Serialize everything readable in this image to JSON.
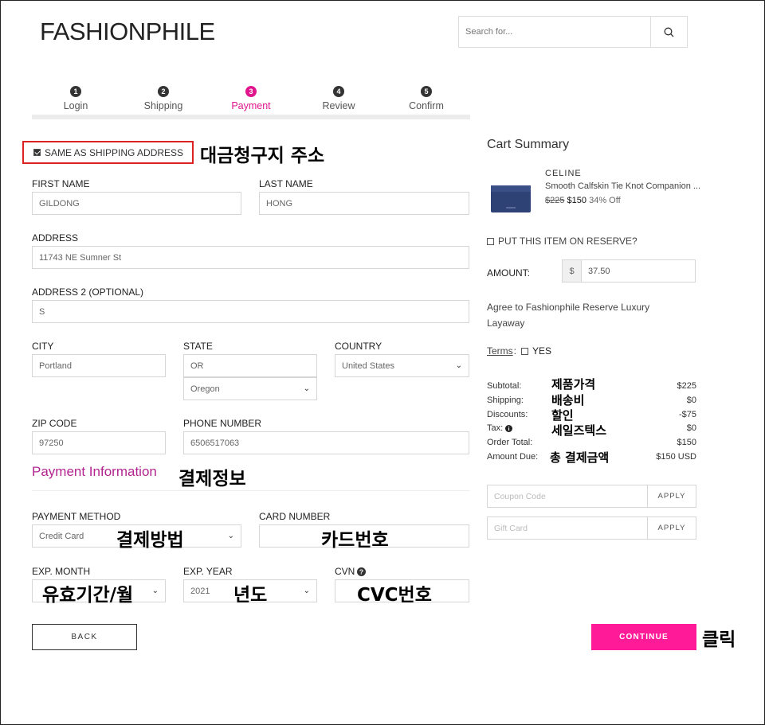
{
  "header": {
    "logo": "FASHIONPHILE",
    "search_placeholder": "Search for..."
  },
  "steps": [
    {
      "num": "1",
      "label": "Login"
    },
    {
      "num": "2",
      "label": "Shipping"
    },
    {
      "num": "3",
      "label": "Payment",
      "active": true
    },
    {
      "num": "4",
      "label": "Review"
    },
    {
      "num": "5",
      "label": "Confirm"
    }
  ],
  "billing": {
    "same_as_shipping": "SAME AS SHIPPING ADDRESS",
    "same_as_shipping_checked": true,
    "first_name_label": "FIRST NAME",
    "first_name": "GILDONG",
    "last_name_label": "LAST NAME",
    "last_name": "HONG",
    "address_label": "ADDRESS",
    "address": "11743 NE Sumner St",
    "address2_label": "ADDRESS 2 (OPTIONAL)",
    "address2": "S",
    "city_label": "CITY",
    "city": "Portland",
    "state_label": "STATE",
    "state": "OR",
    "state_select": "Oregon",
    "country_label": "COUNTRY",
    "country": "United States",
    "zip_label": "ZIP CODE",
    "zip": "97250",
    "phone_label": "PHONE NUMBER",
    "phone": "6506517063"
  },
  "payment": {
    "title": "Payment Information",
    "method_label": "PAYMENT METHOD",
    "method": "Credit Card",
    "card_number_label": "CARD NUMBER",
    "card_number": "",
    "exp_month_label": "EXP. MONTH",
    "exp_month": "",
    "exp_year_label": "EXP. YEAR",
    "exp_year": "2021",
    "cvn_label": "CVN",
    "cvn": ""
  },
  "buttons": {
    "back": "BACK",
    "continue": "CONTINUE"
  },
  "cart": {
    "title": "Cart Summary",
    "item": {
      "brand": "CELINE",
      "name": "Smooth Calfskin Tie Knot Companion ...",
      "old_price": "$225",
      "price": "$150",
      "discount": "34% Off"
    },
    "reserve_label": "PUT THIS ITEM ON RESERVE?",
    "amount_label": "AMOUNT:",
    "currency": "$",
    "amount": "37.50",
    "agree_text": "Agree to Fashionphile Reserve Luxury Layaway",
    "terms": "Terms",
    "terms_colon": ":",
    "yes": "YES",
    "summary": [
      {
        "label": "Subtotal:",
        "value": "$225"
      },
      {
        "label": "Shipping:",
        "value": "$0"
      },
      {
        "label": "Discounts:",
        "value": "-$75"
      },
      {
        "label": "Tax:",
        "value": "$0"
      },
      {
        "label": "Order Total:",
        "value": "$150"
      },
      {
        "label": "Amount Due:",
        "value": "$150 USD"
      }
    ],
    "coupon_placeholder": "Coupon Code",
    "gift_placeholder": "Gift Card",
    "apply": "APPLY"
  },
  "annotations": {
    "billing_address": "대금청구지 주소",
    "payment_info": "결제정보",
    "payment_method": "결제방법",
    "card_number": "카드번호",
    "exp_month": "유효기간/월",
    "exp_year": "년도",
    "cvc": "CVC번호",
    "click": "클릭",
    "product_price": "제품가격",
    "shipping_fee": "배송비",
    "discount": "할인",
    "sales_tax": "세일즈텍스",
    "total_payment": "총 결제금액"
  },
  "colors": {
    "accent": "#e0158d",
    "continue_bg": "#ff1b97",
    "highlight_border": "#dd2222",
    "payment_title": "#b2258f"
  }
}
